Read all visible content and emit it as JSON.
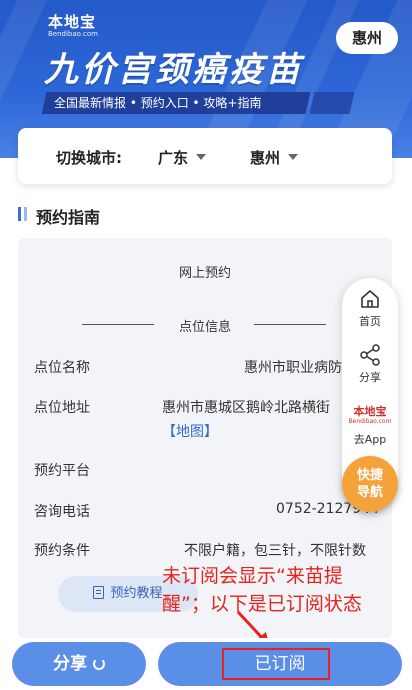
{
  "banner": {
    "logo_main": "本地宝",
    "logo_sub": "Bendibao.com",
    "title": "九价宫颈癌疫苗",
    "subtitle": "全国最新情报 • 预约入口 • 攻略+指南",
    "city_button": "惠州"
  },
  "switcher": {
    "label": "切换城市:",
    "province": "广东",
    "city": "惠州"
  },
  "section": {
    "title": "预约指南"
  },
  "info": {
    "mode": "网上预约",
    "divider_title": "点位信息",
    "rows": [
      {
        "label": "点位名称",
        "value": "惠州市职业病防"
      },
      {
        "label": "点位地址",
        "value": "惠州市惠城区鹅岭北路横街"
      },
      {
        "label": "预约平台",
        "value": ""
      },
      {
        "label": "咨询电话",
        "value": "0752-2127944"
      },
      {
        "label": "预约条件",
        "value": "不限户籍，包三针，不限针数"
      }
    ],
    "map_link": "【地图】",
    "guide_button": "预约教程"
  },
  "side_panel": {
    "home": "首页",
    "share": "分享",
    "logo_main": "本地宝",
    "logo_sub": "Bendibao.com",
    "go_app": "去App",
    "quick_nav_line1": "快捷",
    "quick_nav_line2": "导航"
  },
  "annotation": {
    "line1": "未订阅会显示“来苗提",
    "line2": "醒”；以下是已订阅状态",
    "color": "#e8231e"
  },
  "bottom": {
    "share_label": "分享",
    "subscribe_label": "已订阅"
  },
  "colors": {
    "banner_blue": "#2d67d8",
    "button_blue": "#5b8ee6",
    "quick_nav_orange": "#f5a23a",
    "link_blue": "#2f6ad4"
  }
}
